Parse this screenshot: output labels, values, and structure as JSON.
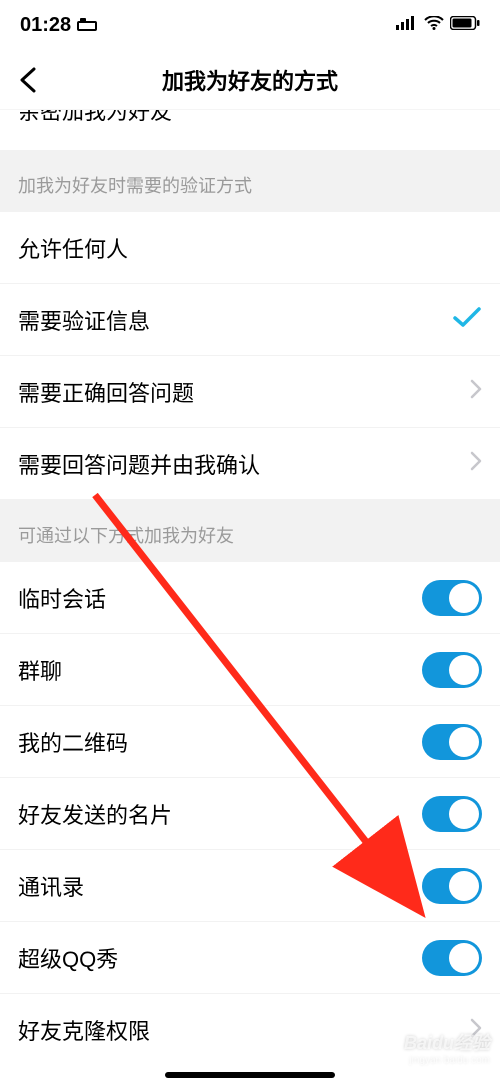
{
  "status": {
    "time": "01:28"
  },
  "nav": {
    "title": "加我为好友的方式"
  },
  "cutoff": {
    "label": "亲密加我为好友"
  },
  "section1": {
    "header": "加我为好友时需要的验证方式",
    "items": [
      {
        "label": "允许任何人",
        "type": "none"
      },
      {
        "label": "需要验证信息",
        "type": "check"
      },
      {
        "label": "需要正确回答问题",
        "type": "chevron"
      },
      {
        "label": "需要回答问题并由我确认",
        "type": "chevron"
      }
    ]
  },
  "section2": {
    "header": "可通过以下方式加我为好友",
    "items": [
      {
        "label": "临时会话",
        "on": true
      },
      {
        "label": "群聊",
        "on": true
      },
      {
        "label": "我的二维码",
        "on": true
      },
      {
        "label": "好友发送的名片",
        "on": true
      },
      {
        "label": "通讯录",
        "on": true
      },
      {
        "label": "超级QQ秀",
        "on": true
      }
    ],
    "last": {
      "label": "好友克隆权限"
    }
  },
  "watermark": {
    "brand": "Baidu经验",
    "sub": "jingyan.baidu.com"
  }
}
